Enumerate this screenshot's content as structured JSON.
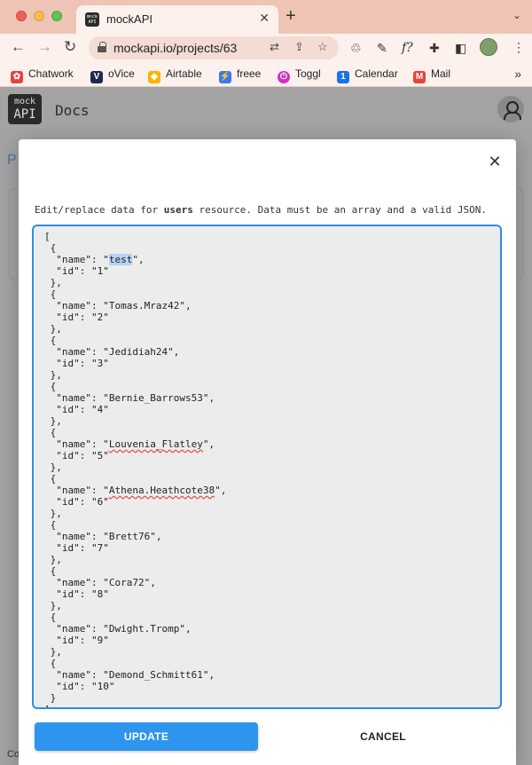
{
  "browser": {
    "tab_title": "mockAPI",
    "tab_favicon_text": "mock API",
    "url": "mockapi.io/projects/63",
    "bookmarks": [
      {
        "label": "Chatwork",
        "color": "#e8423f",
        "glyph": "✿"
      },
      {
        "label": "oVice",
        "color": "#1d2b4f",
        "glyph": "V"
      },
      {
        "label": "Airtable",
        "color": "#f7b500",
        "glyph": "◆"
      },
      {
        "label": "freee",
        "color": "#3c78f0",
        "glyph": "⚡"
      },
      {
        "label": "Toggl",
        "color": "#d42fc4",
        "glyph": "⏻"
      },
      {
        "label": "Calendar",
        "color": "#1a73e8",
        "glyph": "1"
      },
      {
        "label": "Mail",
        "color": "#ea4335",
        "glyph": "M"
      }
    ],
    "more_bookmarks": "»"
  },
  "page": {
    "logo_top": "mock",
    "logo_bottom": "API",
    "title": "Docs",
    "bg_text": "P",
    "footer_text": "Co"
  },
  "modal": {
    "description_prefix": "Edit/replace data for ",
    "resource_name": "users",
    "description_suffix": " resource. Data must be an array and a valid JSON.",
    "update_label": "UPDATE",
    "cancel_label": "CANCEL",
    "close_glyph": "✕"
  },
  "users": [
    {
      "name": "test",
      "id": "1"
    },
    {
      "name": "Tomas.Mraz42",
      "id": "2"
    },
    {
      "name": "Jedidiah24",
      "id": "3"
    },
    {
      "name": "Bernie_Barrows53",
      "id": "4"
    },
    {
      "name": "Louvenia_Flatley",
      "id": "5"
    },
    {
      "name": "Athena.Heathcote38",
      "id": "6"
    },
    {
      "name": "Brett76",
      "id": "7"
    },
    {
      "name": "Cora72",
      "id": "8"
    },
    {
      "name": "Dwight.Tromp",
      "id": "9"
    },
    {
      "name": "Demond_Schmitt61",
      "id": "10"
    }
  ],
  "editor_state": {
    "selected_name_index": 0,
    "misspelled_name_indices": [
      4,
      5
    ]
  },
  "colors": {
    "accent": "#2d95ee",
    "tabbar": "#f0c4b4",
    "chrome": "#fdf1ed"
  }
}
